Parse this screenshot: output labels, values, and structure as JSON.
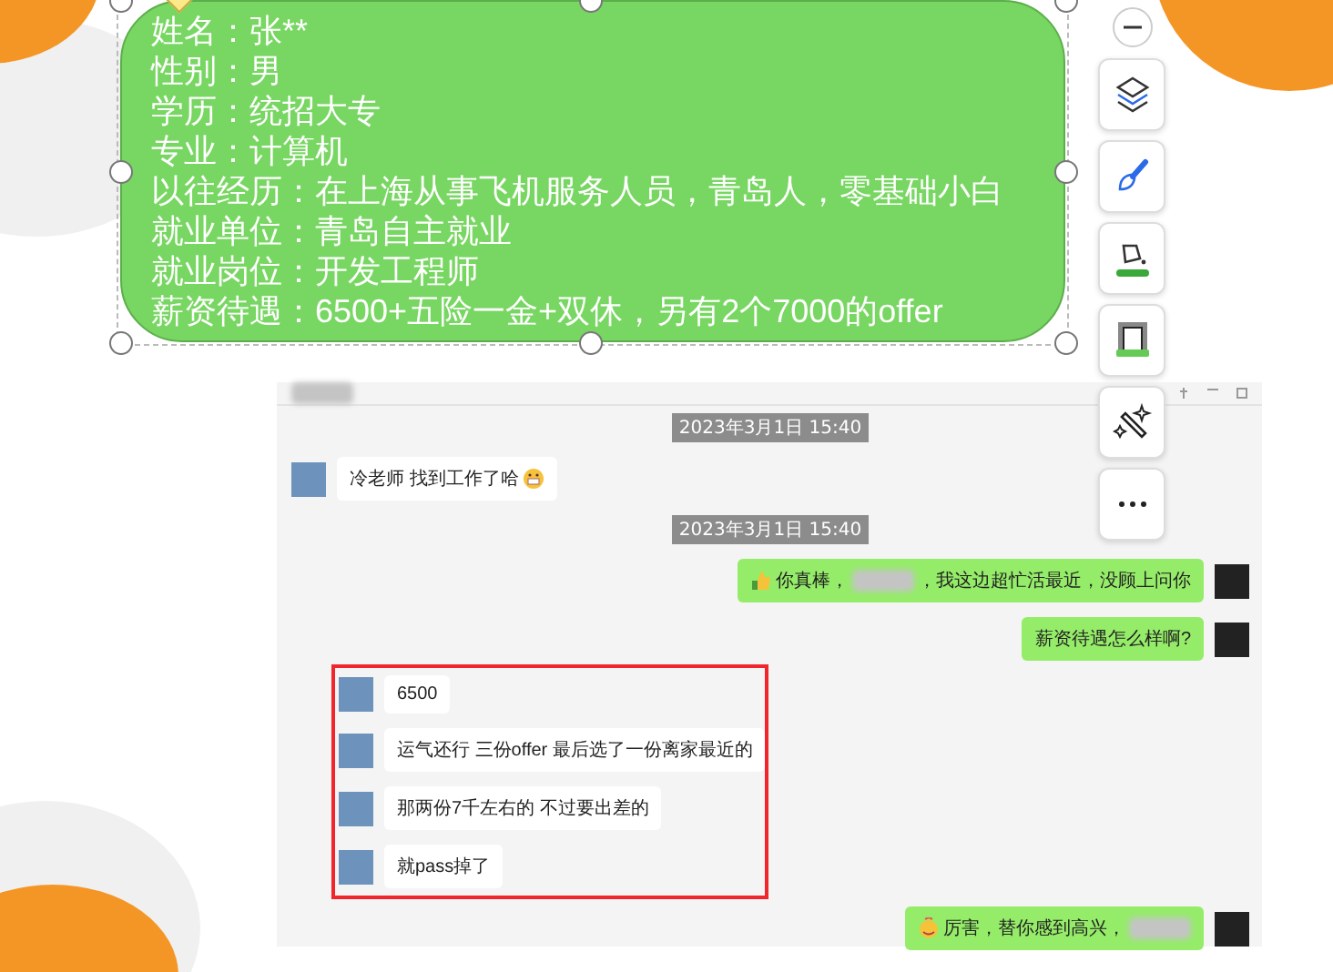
{
  "card": {
    "lines": [
      "姓名：张**",
      "性别：男",
      "学历：统招大专",
      "专业：计算机",
      "以往经历：在上海从事飞机服务人员，青岛人，零基础小白",
      "就业单位：青岛自主就业",
      "就业岗位：开发工程师",
      "薪资待遇：6500+五险一金+双休，另有2个7000的offer"
    ]
  },
  "toolbar": {
    "buttons": [
      {
        "kind": "layers"
      },
      {
        "kind": "brush"
      },
      {
        "kind": "fill"
      },
      {
        "kind": "border"
      },
      {
        "kind": "magic"
      },
      {
        "kind": "more"
      }
    ]
  },
  "chat": {
    "messages": [
      {
        "kind": "time",
        "text": "2023年3月1日 15:40"
      },
      {
        "kind": "in",
        "parts": [
          {
            "kind": "text",
            "text": "冷老师  找到工作了哈"
          },
          {
            "kind": "grin"
          }
        ],
        "highlighted": false
      },
      {
        "kind": "time",
        "text": "2023年3月1日 15:40"
      },
      {
        "kind": "out",
        "parts": [
          {
            "kind": "thumb"
          },
          {
            "kind": "text",
            "text": "你真棒，"
          },
          {
            "kind": "blur"
          },
          {
            "kind": "text",
            "text": "，我这边超忙活最近，没顾上问你"
          }
        ],
        "highlighted": false
      },
      {
        "kind": "out",
        "parts": [
          {
            "kind": "text",
            "text": "薪资待遇怎么样啊?"
          }
        ],
        "highlighted": false
      },
      {
        "kind": "in",
        "parts": [
          {
            "kind": "text",
            "text": "6500"
          }
        ],
        "highlighted": true
      },
      {
        "kind": "in",
        "parts": [
          {
            "kind": "text",
            "text": "运气还行  三份offer 最后选了一份离家最近的"
          }
        ],
        "highlighted": true
      },
      {
        "kind": "in",
        "parts": [
          {
            "kind": "text",
            "text": "那两份7千左右的  不过要出差的"
          }
        ],
        "highlighted": true
      },
      {
        "kind": "in",
        "parts": [
          {
            "kind": "text",
            "text": "就pass掉了"
          }
        ],
        "highlighted": true
      },
      {
        "kind": "out",
        "parts": [
          {
            "kind": "smile"
          },
          {
            "kind": "text",
            "text": "厉害，替你感到高兴，"
          },
          {
            "kind": "blur"
          }
        ],
        "highlighted": false
      }
    ]
  }
}
